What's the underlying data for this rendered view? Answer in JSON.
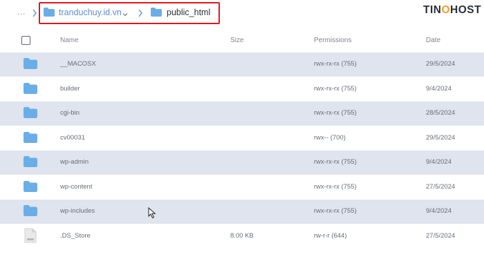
{
  "breadcrumb": {
    "root": "...",
    "domain": "tranduchuy.id.vn",
    "current": "public_html"
  },
  "brand": {
    "text_a": "TIN",
    "text_o": "O",
    "text_b": "HOST"
  },
  "table": {
    "headers": {
      "name": "Name",
      "size": "Size",
      "permissions": "Permissions",
      "date": "Date"
    },
    "rows": [
      {
        "type": "folder",
        "name": "__MACOSX",
        "size": "",
        "permissions": "rwx-rx-rx (755)",
        "date": "29/5/2024"
      },
      {
        "type": "folder",
        "name": "builder",
        "size": "",
        "permissions": "rwx-rx-rx (755)",
        "date": "9/4/2024"
      },
      {
        "type": "folder",
        "name": "cgi-bin",
        "size": "",
        "permissions": "rwx-rx-rx (755)",
        "date": "28/5/2024"
      },
      {
        "type": "folder",
        "name": "cv00031",
        "size": "",
        "permissions": "rwx-- (700)",
        "date": "29/5/2024"
      },
      {
        "type": "folder",
        "name": "wp-admin",
        "size": "",
        "permissions": "rwx-rx-rx (755)",
        "date": "9/4/2024"
      },
      {
        "type": "folder",
        "name": "wp-content",
        "size": "",
        "permissions": "rwx-rx-rx (755)",
        "date": "27/5/2024"
      },
      {
        "type": "folder",
        "name": "wp-includes",
        "size": "",
        "permissions": "rwx-rx-rx (755)",
        "date": "9/4/2024"
      },
      {
        "type": "file",
        "name": ".DS_Store",
        "size": "8.00 KB",
        "permissions": "rw-r-r (644)",
        "date": "27/5/2024"
      }
    ]
  },
  "colors": {
    "folder": "#6aaee8",
    "row_shade": "#dfe4ee",
    "highlight": "#e4151c",
    "link": "#5e8fcf",
    "brand_accent": "#f59a1c"
  },
  "icons": {
    "folder": "folder-icon",
    "file": "file-icon",
    "separator": "chevron-right-icon",
    "dropdown": "chevron-down-icon",
    "cursor": "mouse-pointer-icon"
  }
}
